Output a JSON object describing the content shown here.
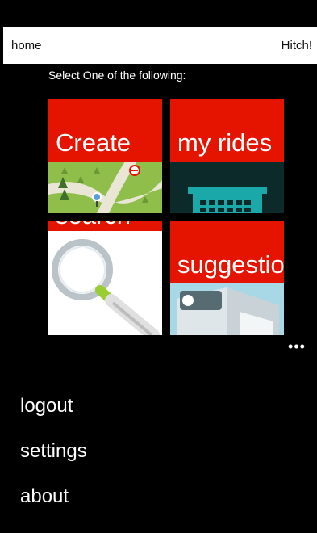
{
  "header": {
    "left_title": "home",
    "right_title": "Hitch!"
  },
  "prompt": "Select One of the following:",
  "tiles": [
    {
      "label": "Create",
      "icon": "map-icon"
    },
    {
      "label": "my rides",
      "icon": "parking-building-icon"
    },
    {
      "label": "search",
      "icon": "magnifier-icon"
    },
    {
      "label": "suggestions",
      "icon": "suggestion-box-icon"
    }
  ],
  "app_bar": {
    "more_label": "•••"
  },
  "menu": [
    {
      "label": "logout"
    },
    {
      "label": "settings"
    },
    {
      "label": "about"
    }
  ],
  "colors": {
    "accent": "#e51400",
    "background": "#000000",
    "header": "#ffffff"
  }
}
